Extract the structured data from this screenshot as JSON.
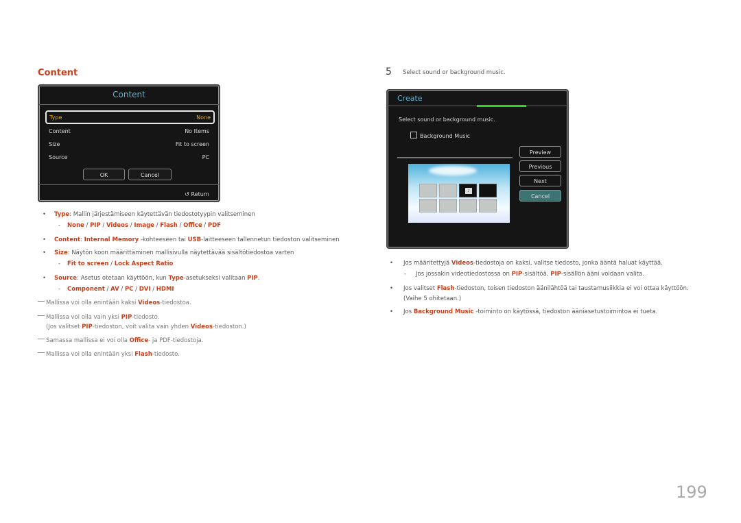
{
  "left_section": {
    "heading": "Content",
    "dialog": {
      "title": "Content",
      "rows": [
        {
          "label": "Type",
          "value": "None",
          "selected": true
        },
        {
          "label": "Content",
          "value": "No Items",
          "selected": false
        },
        {
          "label": "Size",
          "value": "Fit to screen",
          "selected": false
        },
        {
          "label": "Source",
          "value": "PC",
          "selected": false
        }
      ],
      "ok_label": "OK",
      "cancel_label": "Cancel",
      "return_label": "Return",
      "return_icon": "return-icon"
    },
    "bullets": [
      {
        "term": "Type",
        "text": ": Mallin järjestämiseen käytettävän tiedostotyypin valitseminen",
        "sub": [
          "None",
          "PIP",
          "Videos",
          "Image",
          "Flash",
          "Office",
          "PDF"
        ]
      },
      {
        "term": "Content",
        "text_parts": [
          ": ",
          "Internal Memory",
          " -kohteeseen tai ",
          "USB",
          "-laitteeseen tallennetun tiedoston valitseminen"
        ]
      },
      {
        "term": "Size",
        "text": ": Näytön koon määrittäminen mallisivulla näytettävää sisältötiedostoa varten",
        "sub": [
          "Fit to screen",
          "Lock Aspect Ratio"
        ]
      },
      {
        "term": "Source",
        "text_parts": [
          ": Asetus otetaan käyttöön, kun ",
          "Type",
          "-asetukseksi valitaan ",
          "PIP",
          "."
        ],
        "sub": [
          "Component",
          "AV",
          "PC",
          "DVI",
          "HDMI"
        ]
      }
    ],
    "separator": " / ",
    "notes": [
      {
        "parts": [
          "Mallissa voi olla enintään kaksi ",
          "Videos",
          "-tiedostoa."
        ]
      },
      {
        "parts": [
          "Mallissa voi olla vain yksi ",
          "PIP",
          "-tiedosto."
        ],
        "extra": [
          "(Jos valitset ",
          "PIP",
          "-tiedoston, voit valita vain yhden ",
          "Videos",
          "-tiedoston.)"
        ]
      },
      {
        "parts": [
          "Samassa mallissa ei voi olla ",
          "Office",
          "- ja PDF-tiedostoja."
        ]
      },
      {
        "parts": [
          "Mallissa voi olla enintään yksi ",
          "Flash",
          "-tiedosto."
        ]
      }
    ]
  },
  "right_section": {
    "step_number": "5",
    "step_text": "Select sound or background music.",
    "dialog": {
      "title": "Create",
      "instruction": "Select sound or background music.",
      "checkbox_label": "Background Music",
      "checkbox_checked": false,
      "buttons": [
        "Preview",
        "Previous",
        "Next",
        "Cancel"
      ],
      "active_button": "Cancel",
      "progress_color": "#2bd42b"
    },
    "bullets": [
      {
        "parts": [
          "Jos määritettyjä ",
          "Videos",
          "-tiedostoja on kaksi, valitse tiedosto, jonka ääntä haluat käyttää."
        ],
        "sub": [
          "Jos jossakin videotiedostossa on ",
          "PIP",
          "-sisältöä, ",
          "PIP",
          "-sisällön ääni voidaan valita."
        ]
      },
      {
        "parts": [
          "Jos valitset ",
          "Flash",
          "-tiedoston, toisen tiedoston äänilähtöä tai taustamusiikkia ei voi ottaa käyttöön."
        ],
        "line2": "(Vaihe 5 ohitetaan.)"
      },
      {
        "parts": [
          "Jos ",
          "Background Music",
          " -toiminto on käytössä, tiedoston ääniasetustoimintoa ei tueta."
        ]
      }
    ]
  },
  "page_number": "199",
  "colors": {
    "accent": "#c8401a",
    "dialog_title": "#5ab4d6",
    "selected_text": "#e1a81e",
    "dialog_bg": "#151515"
  }
}
